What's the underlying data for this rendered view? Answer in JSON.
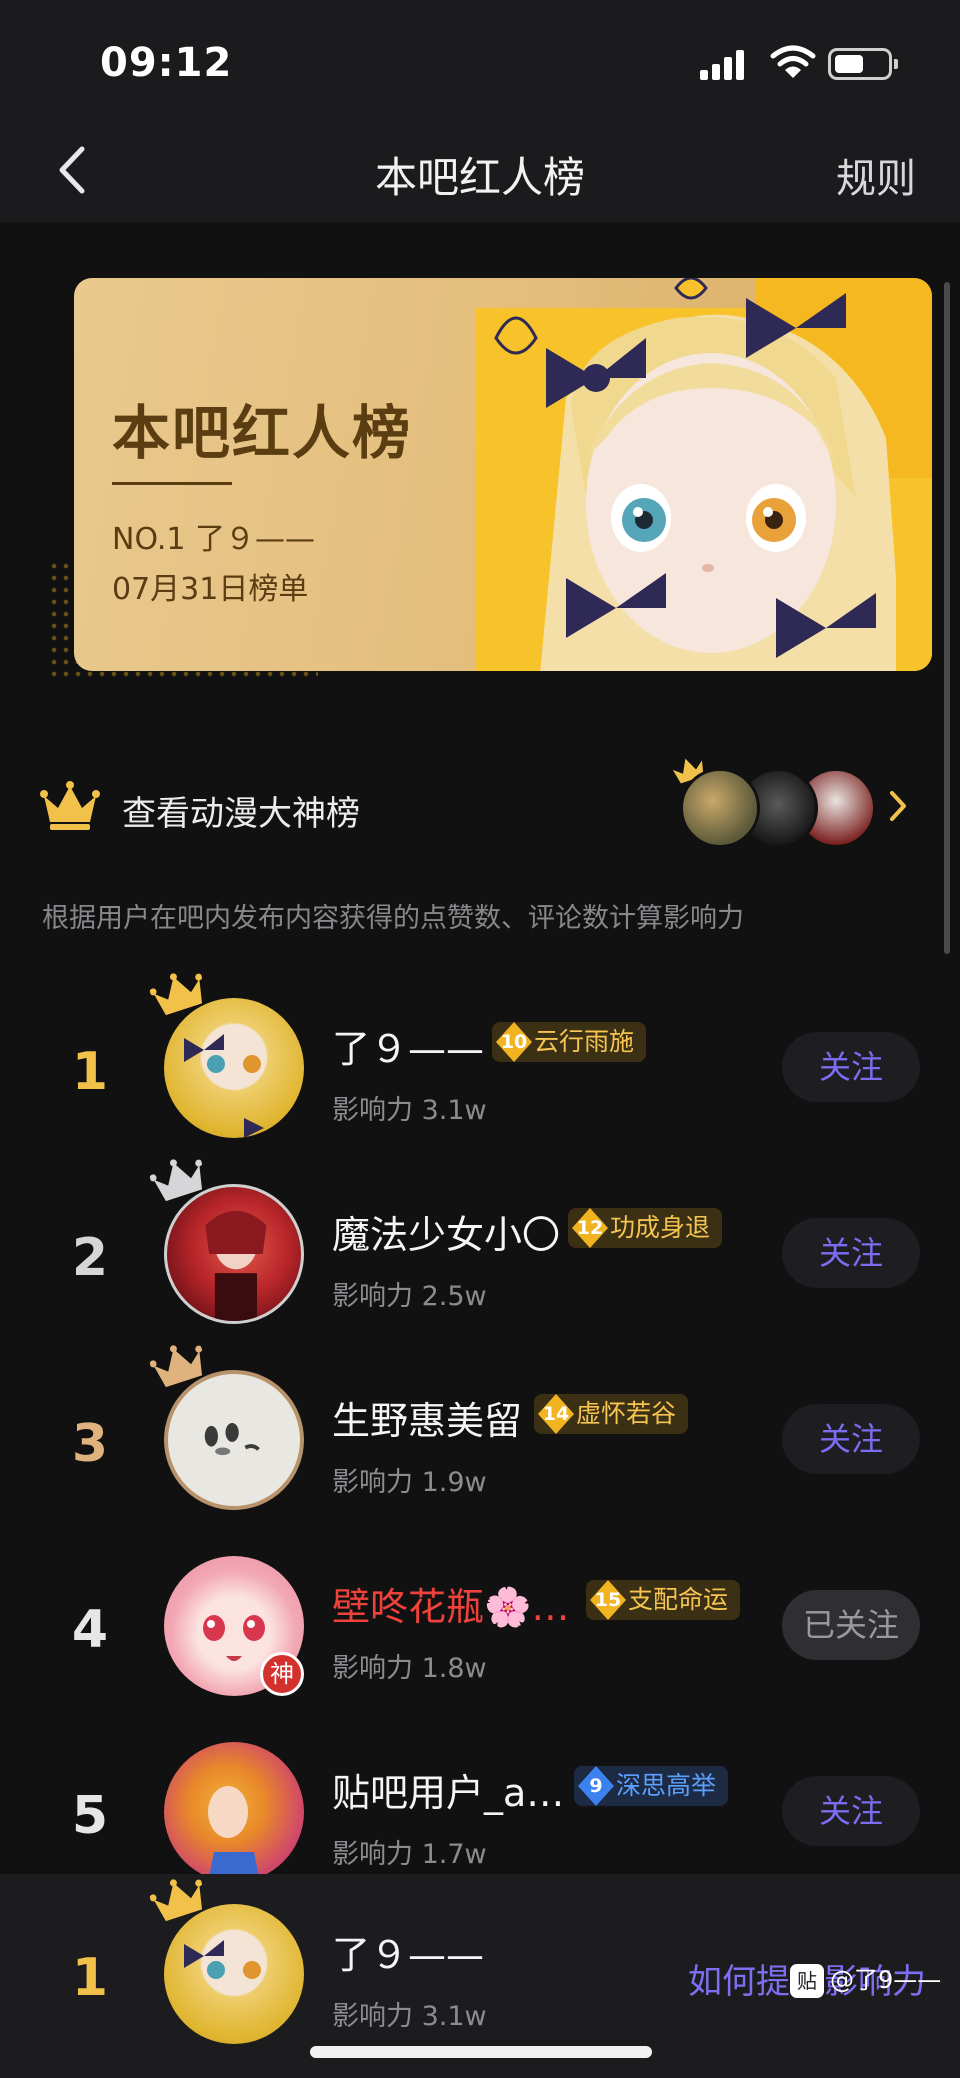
{
  "status": {
    "time": "09:12"
  },
  "nav": {
    "title": "本吧红人榜",
    "rules": "规则"
  },
  "banner": {
    "title": "本吧红人榜",
    "no1": "NO.1 了９——",
    "date": "07月31日榜单"
  },
  "gods": {
    "label": "查看动漫大神榜"
  },
  "description": "根据用户在吧内发布内容获得的点赞数、评论数计算影响力",
  "ranks": [
    {
      "rank": "1",
      "name": "了９——",
      "level": "10",
      "title": "云行雨施",
      "influence": "影响力 3.1w",
      "follow": "关注",
      "rank_color": "#f2c14a",
      "crown_color": "#f2c14a"
    },
    {
      "rank": "2",
      "name": "魔法少女小〇",
      "level": "12",
      "title": "功成身退",
      "influence": "影响力 2.5w",
      "follow": "关注",
      "rank_color": "#d6d6d8",
      "crown_color": "#d6d6d8"
    },
    {
      "rank": "3",
      "name": "生野惠美留",
      "level": "14",
      "title": "虚怀若谷",
      "influence": "影响力 1.9w",
      "follow": "关注",
      "rank_color": "#e0b27e",
      "crown_color": "#e0b27e"
    },
    {
      "rank": "4",
      "name": "壁咚花瓶🌸…",
      "level": "15",
      "title": "支配命运",
      "influence": "影响力 1.8w",
      "follow": "已关注",
      "rank_color": "#e6e6e8",
      "badge": "神"
    },
    {
      "rank": "5",
      "name": "贴吧用户_a…",
      "level": "9",
      "title": "深思高举",
      "influence": "影响力 1.7w",
      "follow": "关注",
      "rank_color": "#e6e6e8"
    }
  ],
  "me": {
    "rank": "1",
    "name": "了９——",
    "influence": "影响力 3.1w",
    "how_link": "如何提升影响力"
  },
  "watermark": {
    "logo": "贴",
    "text": "@了9——"
  },
  "colors": {
    "accent": "#7b6cf0",
    "gold": "#f2c14a",
    "background": "#111112"
  }
}
